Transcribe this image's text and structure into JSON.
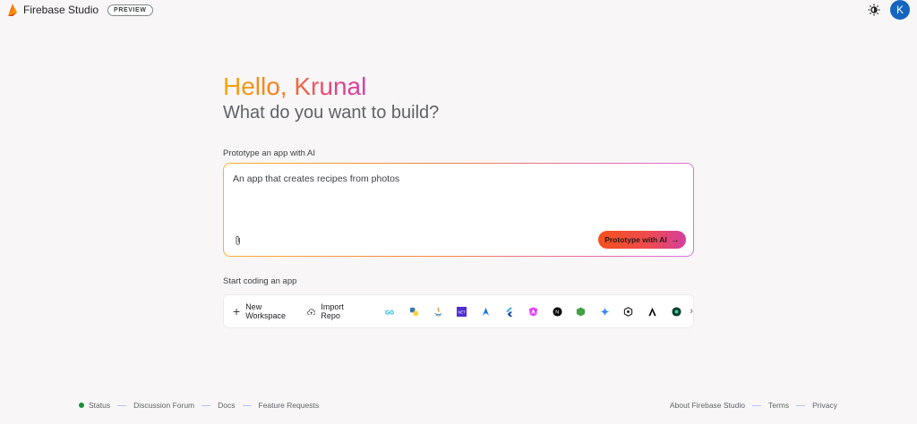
{
  "header": {
    "brand_name": "Firebase Studio",
    "badge": "PREVIEW",
    "avatar_initial": "K"
  },
  "main": {
    "greeting": "Hello, Krunal",
    "subtitle": "What do you want to build?",
    "prototype_label": "Prototype an app with AI",
    "prompt_placeholder": "An app that creates recipes from photos",
    "prototype_button": "Prototype with AI",
    "coding_label": "Start coding an app",
    "new_workspace": "New Workspace",
    "import_repo": "Import Repo",
    "templates": [
      "go-icon",
      "python-icon",
      "java-icon",
      "dotnet-icon",
      "astro-icon",
      "flutter-icon",
      "angular-icon",
      "nextjs-icon",
      "nodejs-icon",
      "gemini-icon",
      "hexagon-icon",
      "astra-icon",
      "ai-icon"
    ]
  },
  "footer": {
    "left": [
      "Status",
      "Discussion Forum",
      "Docs",
      "Feature Requests"
    ],
    "right": [
      "About Firebase Studio",
      "Terms",
      "Privacy"
    ]
  },
  "colors": {
    "accent_orange": "#f4511e",
    "accent_pink": "#d53f9e",
    "status_green": "#1e8e3e",
    "avatar_blue": "#1565c0"
  }
}
